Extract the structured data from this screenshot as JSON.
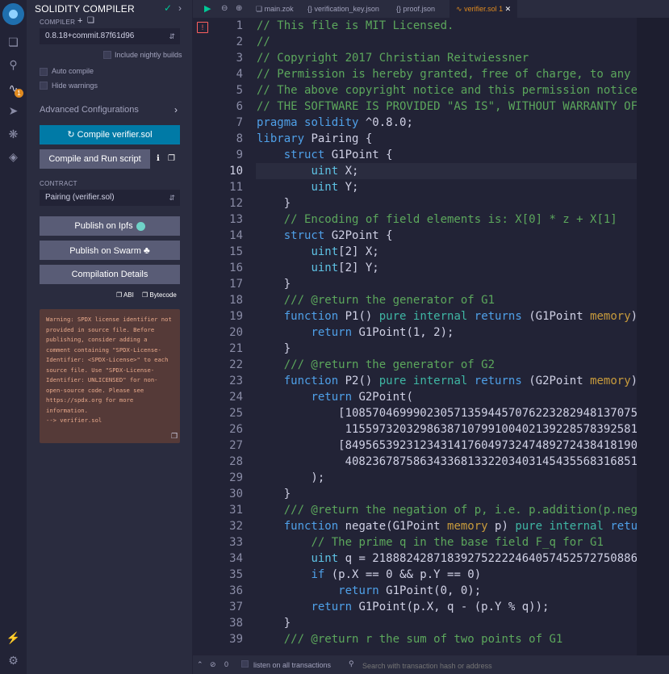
{
  "iconbar": {
    "icons": [
      "remix-logo",
      "file-explorer-icon",
      "search-icon",
      "solidity-compiler-icon",
      "deploy-icon",
      "debugger-icon",
      "plugin-icon",
      "plugin-manager-icon",
      "settings-icon"
    ],
    "badge": "1"
  },
  "panel": {
    "title": "SOLIDITY COMPILER",
    "compiler_label": "COMPILER",
    "compiler_version": "0.8.18+commit.87f61d96",
    "include_nightly": "Include nightly builds",
    "auto_compile": "Auto compile",
    "hide_warnings": "Hide warnings",
    "advanced": "Advanced Configurations",
    "compile_button": "Compile verifier.sol",
    "compile_run_button": "Compile and Run script",
    "contract_label": "CONTRACT",
    "contract_value": "Pairing (verifier.sol)",
    "publish_ipfs": "Publish on Ipfs",
    "publish_swarm": "Publish on Swarm",
    "compilation_details": "Compilation Details",
    "abi": "ABI",
    "bytecode": "Bytecode",
    "warning": "Warning: SPDX license identifier not provided in source file. Before publishing, consider adding a comment containing \"SPDX-License-Identifier: <SPDX-License>\" to each source file. Use \"SPDX-License-Identifier: UNLICENSED\" for non-open-source code. Please see https://spdx.org for more information.\n--> verifier.sol"
  },
  "tabs": [
    {
      "label": "main.zok",
      "icon": "file-icon"
    },
    {
      "label": "verification_key.json",
      "icon": "braces-icon"
    },
    {
      "label": "proof.json",
      "icon": "braces-icon"
    },
    {
      "label": "verifier.sol",
      "icon": "solidity-icon",
      "badge": "1",
      "active": true
    }
  ],
  "editor": {
    "current_line": 10,
    "lines": [
      {
        "n": 1,
        "text": "// This file is MIT Licensed."
      },
      {
        "n": 2,
        "text": "//"
      },
      {
        "n": 3,
        "text": "// Copyright 2017 Christian Reitwiessner"
      },
      {
        "n": 4,
        "text": "// Permission is hereby granted, free of charge, to any pe"
      },
      {
        "n": 5,
        "text": "// The above copyright notice and this permission notice s"
      },
      {
        "n": 6,
        "text": "// THE SOFTWARE IS PROVIDED \"AS IS\", WITHOUT WARRANTY OF A"
      },
      {
        "n": 7,
        "text": "pragma solidity ^0.8.0;"
      },
      {
        "n": 8,
        "text": "library Pairing {"
      },
      {
        "n": 9,
        "text": "    struct G1Point {"
      },
      {
        "n": 10,
        "text": "        uint X;"
      },
      {
        "n": 11,
        "text": "        uint Y;"
      },
      {
        "n": 12,
        "text": "    }"
      },
      {
        "n": 13,
        "text": "    // Encoding of field elements is: X[0] * z + X[1]"
      },
      {
        "n": 14,
        "text": "    struct G2Point {"
      },
      {
        "n": 15,
        "text": "        uint[2] X;"
      },
      {
        "n": 16,
        "text": "        uint[2] Y;"
      },
      {
        "n": 17,
        "text": "    }"
      },
      {
        "n": 18,
        "text": "    /// @return the generator of G1"
      },
      {
        "n": 19,
        "text": "    function P1() pure internal returns (G1Point memory) {"
      },
      {
        "n": 20,
        "text": "        return G1Point(1, 2);"
      },
      {
        "n": 21,
        "text": "    }"
      },
      {
        "n": 22,
        "text": "    /// @return the generator of G2"
      },
      {
        "n": 23,
        "text": "    function P2() pure internal returns (G2Point memory) {"
      },
      {
        "n": 24,
        "text": "        return G2Point("
      },
      {
        "n": 25,
        "text": "            [10857046999023057135944570762232829481370756"
      },
      {
        "n": 26,
        "text": "             1155973203298638710799100402139228578392581"
      },
      {
        "n": 27,
        "text": "            [84956539231234314176049732474892724384181905"
      },
      {
        "n": 28,
        "text": "             4082367875863433681332203403145435568316851"
      },
      {
        "n": 29,
        "text": "        );"
      },
      {
        "n": 30,
        "text": "    }"
      },
      {
        "n": 31,
        "text": "    /// @return the negation of p, i.e. p.addition(p.negat"
      },
      {
        "n": 32,
        "text": "    function negate(G1Point memory p) pure internal return"
      },
      {
        "n": 33,
        "text": "        // The prime q in the base field F_q for G1"
      },
      {
        "n": 34,
        "text": "        uint q = 2188824287183927522224640574525727508869"
      },
      {
        "n": 35,
        "text": "        if (p.X == 0 && p.Y == 0)"
      },
      {
        "n": 36,
        "text": "            return G1Point(0, 0);"
      },
      {
        "n": 37,
        "text": "        return G1Point(p.X, q - (p.Y % q));"
      },
      {
        "n": 38,
        "text": "    }"
      },
      {
        "n": 39,
        "text": "    /// @return r the sum of two points of G1"
      }
    ]
  },
  "footer": {
    "count": "0",
    "listen": "listen on all transactions",
    "search_placeholder": "Search with transaction hash or address"
  }
}
